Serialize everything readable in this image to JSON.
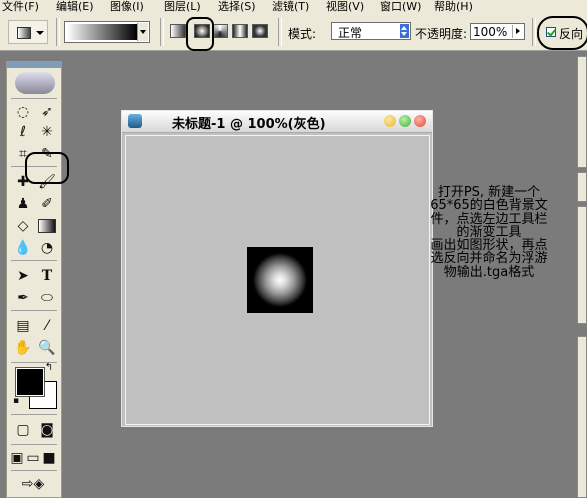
{
  "menu": [
    "文件(F)",
    "编辑(E)",
    "图像(I)",
    "图层(L)",
    "选择(S)",
    "滤镜(T)",
    "视图(V)",
    "窗口(W)",
    "帮助(H)"
  ],
  "options": {
    "mode_label": "模式:",
    "mode_value": "正常",
    "opacity_label": "不透明度:",
    "opacity_value": "100%",
    "reverse_label": "反向",
    "reverse_checked": true,
    "gradient_types": [
      "linear",
      "radial",
      "angle",
      "reflected",
      "diamond"
    ],
    "selected_gradient_type": "radial"
  },
  "document": {
    "title": "未标题-1 @ 100%(灰色)"
  },
  "toolbox": {
    "tools": [
      "marquee",
      "move",
      "lasso",
      "magic-wand",
      "crop",
      "slice",
      "healing-brush",
      "brush",
      "clone-stamp",
      "history-brush",
      "eraser",
      "gradient",
      "blur",
      "dodge",
      "path-select",
      "type",
      "pen",
      "shape",
      "notes",
      "eyedropper",
      "hand",
      "zoom"
    ],
    "selected_tool": "gradient",
    "foreground_color": "#000000",
    "background_color": "#ffffff"
  },
  "note": {
    "lines": [
      "打开PS, 新建一个",
      "65*65的白色背景文",
      "件，点选左边工具栏",
      "的渐变工具",
      "画出如图形状，再点",
      "选反向并命名为浮游",
      "物输出.tga格式"
    ]
  },
  "colors": {
    "workspace": "#7b7b7b",
    "chrome": "#ece9d8",
    "canvas": "#c0c0c0",
    "close": "#e04a3a",
    "minimize": "#e6b830",
    "maximize": "#45b03a"
  }
}
